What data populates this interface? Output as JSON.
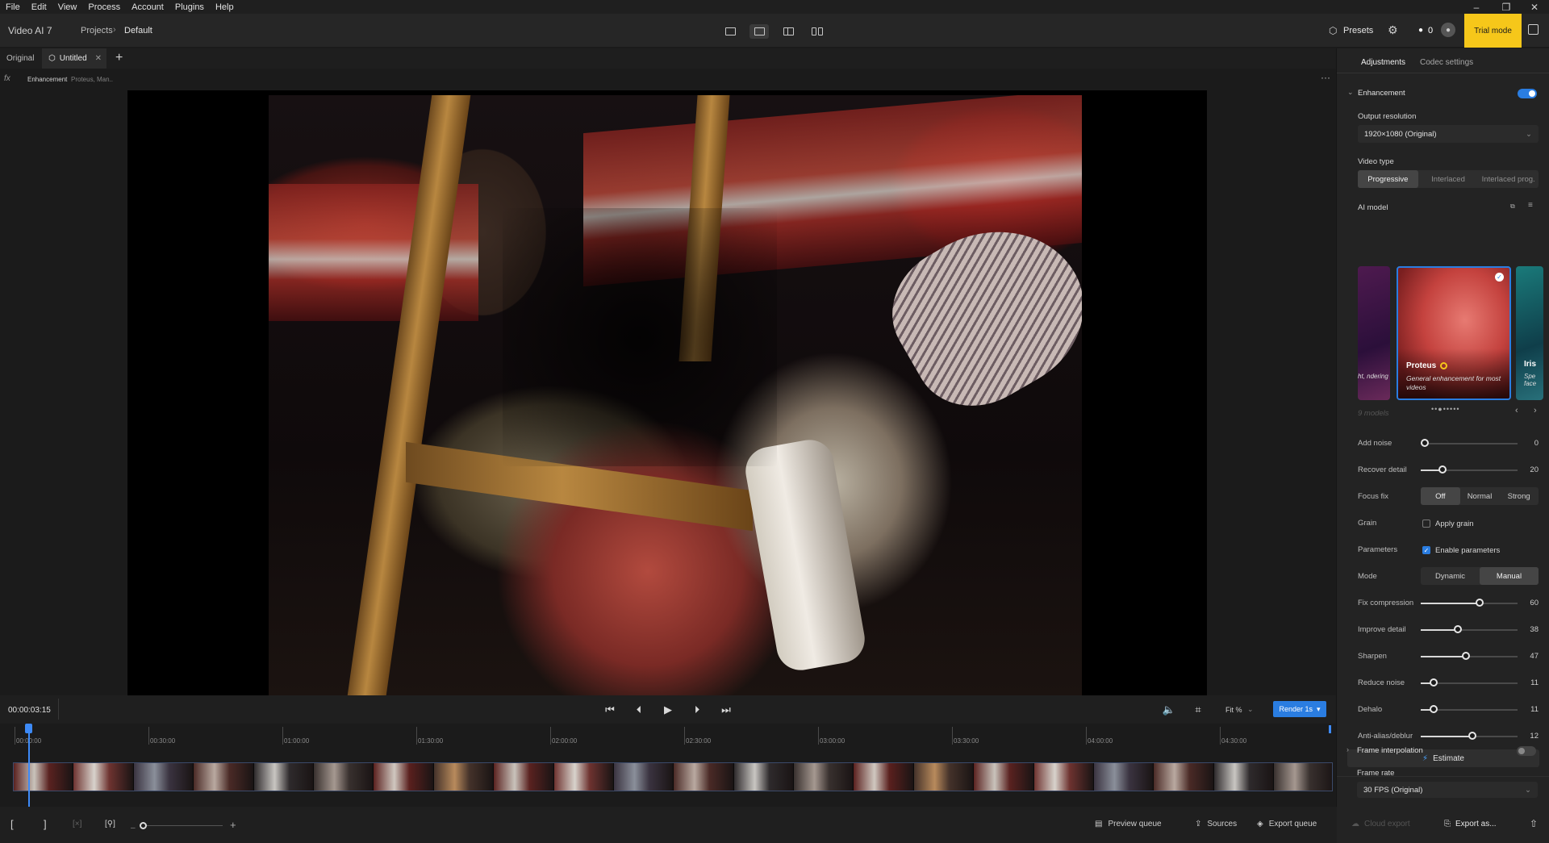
{
  "menu": [
    "File",
    "Edit",
    "View",
    "Process",
    "Account",
    "Plugins",
    "Help"
  ],
  "header": {
    "app_title": "Video AI 7",
    "breadcrumb_projects": "Projects",
    "breadcrumb_current": "Default",
    "presets": "Presets",
    "credits": "0",
    "trial": "Trial mode"
  },
  "tabs": {
    "original": "Original",
    "untitled": "Untitled"
  },
  "enhancement_bar": {
    "label": "Enhancement",
    "detail": "Proteus, Man.."
  },
  "playback": {
    "timecode": "00:00:03:15",
    "fit": "Fit %",
    "render": "Render 1s"
  },
  "timeline": {
    "ticks": [
      "00:00:00",
      "00:30:00",
      "01:00:00",
      "01:30:00",
      "02:00:00",
      "02:30:00",
      "03:00:00",
      "03:30:00",
      "04:00:00",
      "04:30:00"
    ]
  },
  "bottom": {
    "preview_queue": "Preview queue",
    "sources": "Sources",
    "export_queue": "Export queue",
    "cloud_export": "Cloud export",
    "export_as": "Export as..."
  },
  "panel": {
    "tab_adjustments": "Adjustments",
    "tab_codec": "Codec settings",
    "enhancement": "Enhancement",
    "output_resolution_label": "Output resolution",
    "output_resolution": "1920×1080 (Original)",
    "video_type_label": "Video type",
    "video_types": [
      "Progressive",
      "Interlaced",
      "Interlaced prog."
    ],
    "ai_model_label": "AI model",
    "model_left_text": "ht, ndering",
    "model_main_name": "Proteus",
    "model_main_desc": "General enhancement for most videos",
    "model_right_name": "Iris",
    "model_right_desc": "Spe face",
    "models_count": "9 models",
    "add_noise_label": "Add noise",
    "add_noise": "0",
    "recover_detail_label": "Recover detail",
    "recover_detail": "20",
    "focus_fix_label": "Focus fix",
    "focus_fix_options": [
      "Off",
      "Normal",
      "Strong"
    ],
    "grain_label": "Grain",
    "apply_grain": "Apply grain",
    "parameters_label": "Parameters",
    "enable_parameters": "Enable parameters",
    "mode_label": "Mode",
    "mode_options": [
      "Dynamic",
      "Manual"
    ],
    "fix_compression_label": "Fix compression",
    "fix_compression": "60",
    "improve_detail_label": "Improve detail",
    "improve_detail": "38",
    "sharpen_label": "Sharpen",
    "sharpen": "47",
    "reduce_noise_label": "Reduce noise",
    "reduce_noise": "11",
    "dehalo_label": "Dehalo",
    "dehalo": "11",
    "antialias_label": "Anti-alias/deblur",
    "antialias": "12",
    "estimate": "Estimate",
    "frame_interpolation": "Frame interpolation",
    "frame_rate_label": "Frame rate",
    "frame_rate": "30 FPS (Original)"
  },
  "colors": {
    "accent": "#2a7de1",
    "trial": "#f6c71a"
  }
}
